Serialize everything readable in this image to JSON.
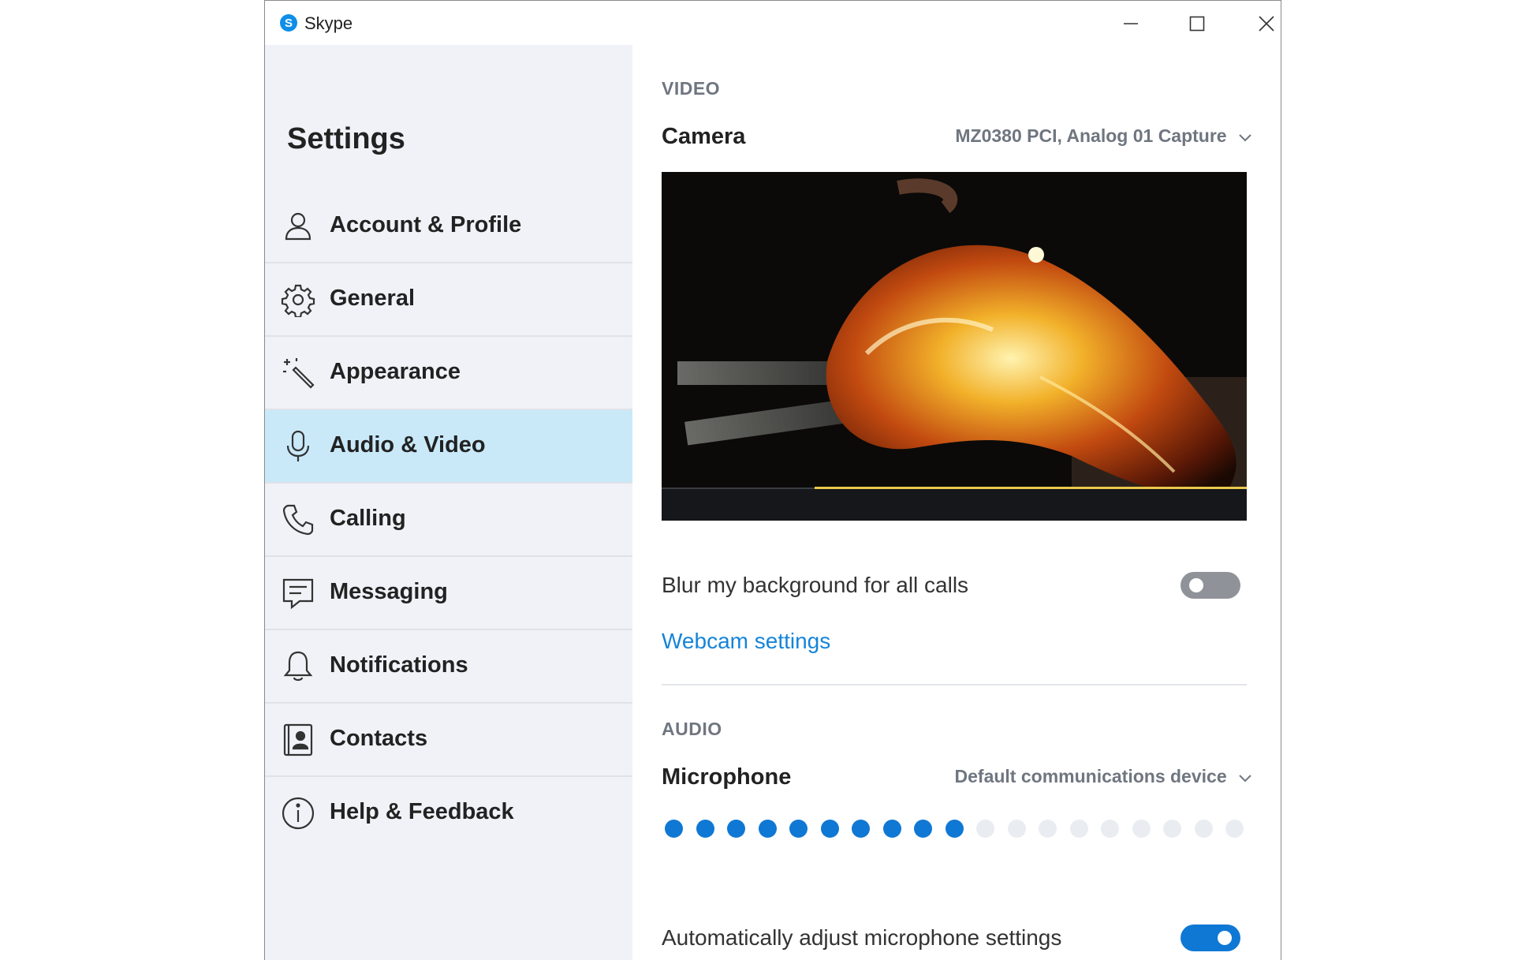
{
  "window": {
    "app_title": "Skype",
    "controls": {
      "minimize": "minimize",
      "maximize": "maximize",
      "close": "close"
    }
  },
  "sidebar": {
    "title": "Settings",
    "items": [
      {
        "label": "Account & Profile",
        "icon": "person-icon",
        "active": false
      },
      {
        "label": "General",
        "icon": "gear-icon",
        "active": false
      },
      {
        "label": "Appearance",
        "icon": "magic-wand-icon",
        "active": false
      },
      {
        "label": "Audio & Video",
        "icon": "microphone-icon",
        "active": true
      },
      {
        "label": "Calling",
        "icon": "phone-icon",
        "active": false
      },
      {
        "label": "Messaging",
        "icon": "message-icon",
        "active": false
      },
      {
        "label": "Notifications",
        "icon": "bell-icon",
        "active": false
      },
      {
        "label": "Contacts",
        "icon": "contact-card-icon",
        "active": false
      },
      {
        "label": "Help & Feedback",
        "icon": "info-icon",
        "active": false
      }
    ]
  },
  "video": {
    "section_label": "VIDEO",
    "camera_label": "Camera",
    "camera_device": "MZ0380 PCI, Analog 01 Capture",
    "preview_alt": "camera-preview",
    "blur_label": "Blur my background for all calls",
    "blur_enabled": false,
    "webcam_settings_link": "Webcam settings"
  },
  "audio": {
    "section_label": "AUDIO",
    "microphone_label": "Microphone",
    "microphone_device": "Default communications device",
    "mic_level": {
      "lit": 10,
      "total": 19
    },
    "auto_adjust_label": "Automatically adjust microphone settings",
    "auto_adjust_enabled": true
  },
  "colors": {
    "accent": "#0f78d4",
    "link": "#1584d9",
    "sidebar_bg": "#f0f2f7",
    "active_item_bg": "#c9e9f9"
  }
}
